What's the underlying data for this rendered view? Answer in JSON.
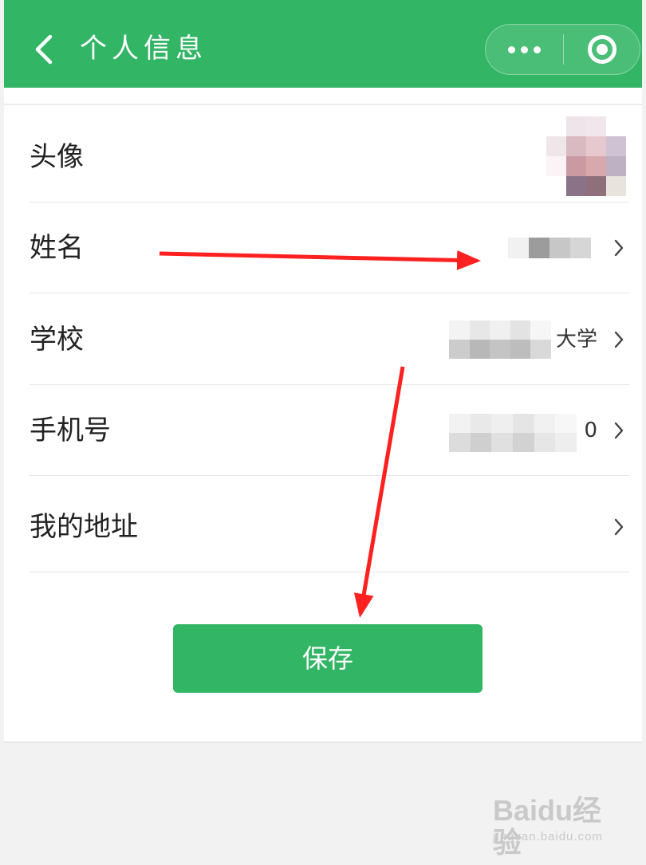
{
  "header": {
    "title": "个人信息",
    "back_icon": "chevron-left-icon",
    "more_icon": "more-dots-icon",
    "close_icon": "target-circle-icon"
  },
  "rows": [
    {
      "label": "头像",
      "value": "",
      "has_chevron": false
    },
    {
      "label": "姓名",
      "value": "",
      "has_chevron": true
    },
    {
      "label": "学校",
      "value": "大学",
      "has_chevron": true
    },
    {
      "label": "手机号",
      "value": "0",
      "has_chevron": true
    },
    {
      "label": "我的地址",
      "value": "",
      "has_chevron": true
    }
  ],
  "save_button": {
    "label": "保存"
  },
  "annotation_color": "#ff2020",
  "colors": {
    "brand_green": "#32b565",
    "background": "#f2f2f2"
  },
  "watermark": {
    "brand": "Baidu经验",
    "url": "jingyan.baidu.com"
  }
}
